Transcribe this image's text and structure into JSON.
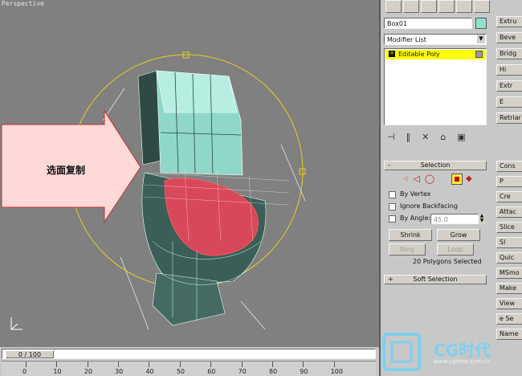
{
  "viewport": {
    "label": "Perspective",
    "callout_text": "选面复制"
  },
  "command_panel": {
    "object_name": "Box01",
    "object_color": "#8fe0cf",
    "modifier_list_label": "Modifier List",
    "stack_item": "Editable Poly",
    "selection": {
      "title": "Selection",
      "by_vertex": "By Vertex",
      "ignore_backfacing": "Ignore Backfacing",
      "by_angle": "By Angle:",
      "angle_value": "45.0",
      "shrink": "Shrink",
      "grow": "Grow",
      "ring": "Ring",
      "loop": "Loop",
      "status": "20 Polygons Selected"
    },
    "soft_selection_title": "Soft Selection",
    "right_column_1": [
      "Extru",
      "Beve",
      "Bridg",
      "Hi",
      "Extr",
      "E",
      "Retriar"
    ],
    "right_column_2": [
      "Cons",
      "P",
      "Cre",
      "Attac",
      "Slice",
      "Sl",
      "Quic",
      "MSmo",
      "Make",
      "View",
      "e Se",
      "Name"
    ]
  },
  "timeline": {
    "frame_label": "0 / 100",
    "ticks": [
      "0",
      "10",
      "20",
      "30",
      "40",
      "50",
      "60",
      "70",
      "80",
      "90",
      "100"
    ]
  },
  "watermark": {
    "brand": "CG时代",
    "url": "www.cgtime.com.cn"
  },
  "colors": {
    "viewport_bg": "#808080",
    "mesh_fill": "#9ee6d6",
    "mesh_dark": "#3c5e58",
    "selected_face": "#d9485a",
    "gizmo": "#e8d020",
    "stack_highlight": "#ffff00"
  }
}
